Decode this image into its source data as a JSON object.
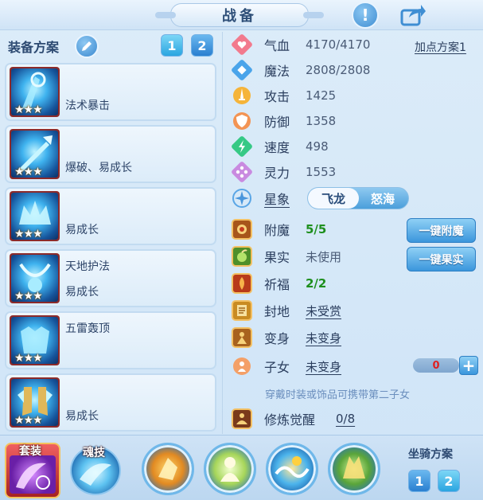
{
  "window": {
    "title": "战备"
  },
  "left_panel": {
    "header": "装备方案",
    "plan_buttons": [
      "1",
      "2"
    ],
    "equipment": [
      {
        "line1": "法术暴击",
        "line2": "",
        "stars": "★★★",
        "icon": "rune-staff-icon"
      },
      {
        "line1": "",
        "line2": "爆破、易成长",
        "stars": "★★★",
        "icon": "ice-trident-icon"
      },
      {
        "line1": "",
        "line2": "易成长",
        "stars": "★★★",
        "icon": "crown-helmet-icon"
      },
      {
        "line1": "天地护法",
        "line2": "易成长",
        "stars": "★★★",
        "icon": "spirit-necklace-icon"
      },
      {
        "line1": "五雷轰顶",
        "line2": "",
        "stars": "★★★",
        "icon": "thunder-armor-icon"
      },
      {
        "line1": "",
        "line2": "易成长",
        "stars": "★★★",
        "icon": "winged-boots-icon"
      }
    ]
  },
  "stats": {
    "plan_link": "加点方案1",
    "rows": [
      {
        "label": "气血",
        "value": "4170/4170",
        "icon": "heart-icon",
        "color": "#e8546a"
      },
      {
        "label": "魔法",
        "value": "2808/2808",
        "icon": "mana-diamond-icon",
        "color": "#3a9ae0"
      },
      {
        "label": "攻击",
        "value": "1425",
        "icon": "sword-icon",
        "color": "#f0a92c"
      },
      {
        "label": "防御",
        "value": "1358",
        "icon": "shield-icon",
        "color": "#f08a4a"
      },
      {
        "label": "速度",
        "value": "498",
        "icon": "speed-bolt-icon",
        "color": "#2fbf7a"
      },
      {
        "label": "灵力",
        "value": "1553",
        "icon": "spirit-star-icon",
        "color": "#c07ad8"
      }
    ],
    "star_label": "星象",
    "star_options": [
      "飞龙",
      "怒海"
    ],
    "extras": [
      {
        "label": "附魔",
        "value": "5/5",
        "icon": "enchant-icon"
      },
      {
        "label": "果实",
        "value": "未使用",
        "icon": "fruit-icon"
      },
      {
        "label": "祈福",
        "value": "2/2",
        "icon": "blessing-icon"
      },
      {
        "label": "封地",
        "value": "未受赏",
        "icon": "fief-icon"
      },
      {
        "label": "变身",
        "value": "未变身",
        "icon": "transform-icon"
      },
      {
        "label": "子女",
        "value": "未变身",
        "icon": "child-icon"
      }
    ],
    "one_click_enchant": "一键附魔",
    "one_click_fruit": "一键果实",
    "child_count": "0",
    "plus": "+",
    "hint": "穿戴时装或饰品可携带第二子女",
    "cultivation_label": "修炼觉醒",
    "cultivation_value": "0/8"
  },
  "bottom": {
    "suit_label": "套装",
    "soul_label": "魂技",
    "mount_label": "坐骑方案",
    "mount_buttons": [
      "1",
      "2"
    ],
    "skills": [
      "fist-skill-icon",
      "sage-skill-icon",
      "wave-skill-icon",
      "beast-skill-icon"
    ]
  }
}
